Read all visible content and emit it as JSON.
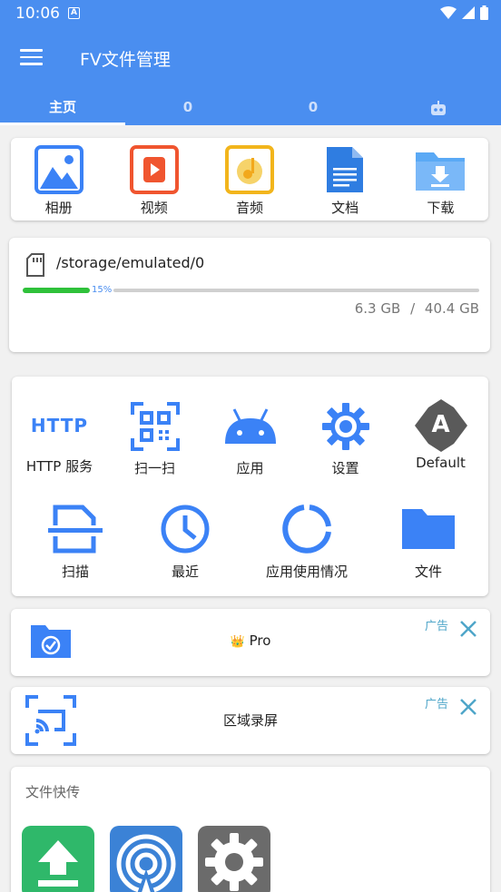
{
  "status_bar": {
    "time": "10:06",
    "badge": "A"
  },
  "app_bar": {
    "title": "FV文件管理"
  },
  "tabs": [
    {
      "label": "主页",
      "active": true
    },
    {
      "label": "0"
    },
    {
      "label": "0"
    },
    {
      "icon": "robot-icon"
    }
  ],
  "quick_access": [
    {
      "label": "相册",
      "icon": "photo-icon",
      "color": "#3b82f6"
    },
    {
      "label": "视频",
      "icon": "video-icon",
      "color": "#f0552f"
    },
    {
      "label": "音频",
      "icon": "audio-icon",
      "color": "#f2b51c"
    },
    {
      "label": "文档",
      "icon": "document-icon",
      "color": "#2f7de1"
    },
    {
      "label": "下载",
      "icon": "download-folder-icon",
      "color": "#5aa9f5"
    }
  ],
  "storage": {
    "path": "/storage/emulated/0",
    "used_percent_label": "15%",
    "used_fraction": 0.15,
    "used": "6.3 GB",
    "separator": "/",
    "total": "40.4 GB"
  },
  "tools": {
    "row1": [
      {
        "label": "HTTP 服务",
        "icon": "http-icon"
      },
      {
        "label": "扫一扫",
        "icon": "qr-scan-icon"
      },
      {
        "label": "应用",
        "icon": "android-icon"
      },
      {
        "label": "设置",
        "icon": "gear-icon"
      },
      {
        "label": "Default",
        "icon": "default-a-icon",
        "glyph": "A"
      }
    ],
    "row2": [
      {
        "label": "扫描",
        "icon": "scanner-icon"
      },
      {
        "label": "最近",
        "icon": "clock-icon"
      },
      {
        "label": "应用使用情况",
        "icon": "usage-chart-icon"
      },
      {
        "label": "文件",
        "icon": "folder-icon"
      }
    ],
    "http_glyph": "HTTP"
  },
  "ads": [
    {
      "text": "Pro",
      "crown": "👑",
      "tag": "广告",
      "icon": "folder-check-icon"
    },
    {
      "text": "区域录屏",
      "tag": "广告",
      "icon": "screen-cast-icon"
    }
  ],
  "file_transfer": {
    "title": "文件快传",
    "apps": [
      {
        "icon": "upload-icon",
        "color": "#2fb86a"
      },
      {
        "icon": "wireless-icon",
        "color": "#3b82d6"
      },
      {
        "icon": "settings-app-icon",
        "color": "#6b6b6b"
      }
    ]
  },
  "colors": {
    "primary": "#4a8ef0",
    "accent_blue": "#3b82f6",
    "progress": "#2fc13a"
  }
}
